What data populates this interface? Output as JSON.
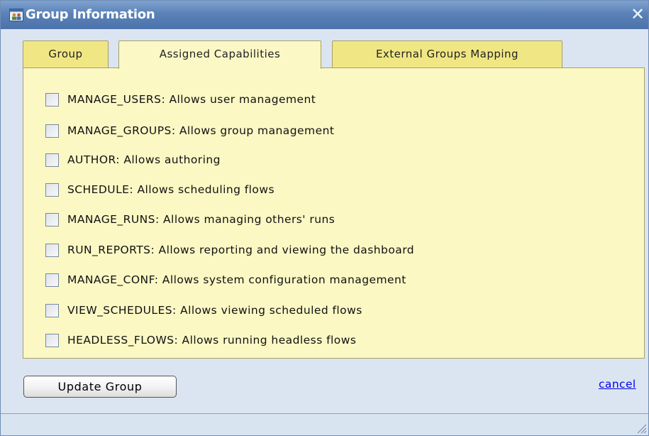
{
  "window": {
    "title": "Group Information",
    "close_glyph": "✕",
    "icon": "group-window-icon"
  },
  "tabs": [
    {
      "label": "Group",
      "active": false
    },
    {
      "label": "Assigned Capabilities",
      "active": true
    },
    {
      "label": "External Groups Mapping",
      "active": false
    }
  ],
  "capabilities": [
    {
      "label": "MANAGE_USERS: Allows user management",
      "checked": false
    },
    {
      "label": "MANAGE_GROUPS: Allows group management",
      "checked": false
    },
    {
      "label": "AUTHOR: Allows authoring",
      "checked": false
    },
    {
      "label": "SCHEDULE: Allows scheduling flows",
      "checked": false
    },
    {
      "label": "MANAGE_RUNS: Allows managing others' runs",
      "checked": false
    },
    {
      "label": "RUN_REPORTS: Allows reporting and viewing the dashboard",
      "checked": false
    },
    {
      "label": "MANAGE_CONF: Allows system configuration management",
      "checked": false
    },
    {
      "label": "VIEW_SCHEDULES: Allows viewing scheduled flows",
      "checked": false
    },
    {
      "label": "HEADLESS_FLOWS: Allows running headless flows",
      "checked": false
    }
  ],
  "actions": {
    "update_label": "Update Group",
    "cancel_label": "cancel"
  },
  "colors": {
    "titlebar": "#5b82b8",
    "tab_active": "#fbf8c6",
    "tab_inactive": "#f0e784",
    "panel": "#fbf8c4",
    "link": "#0000ee"
  }
}
